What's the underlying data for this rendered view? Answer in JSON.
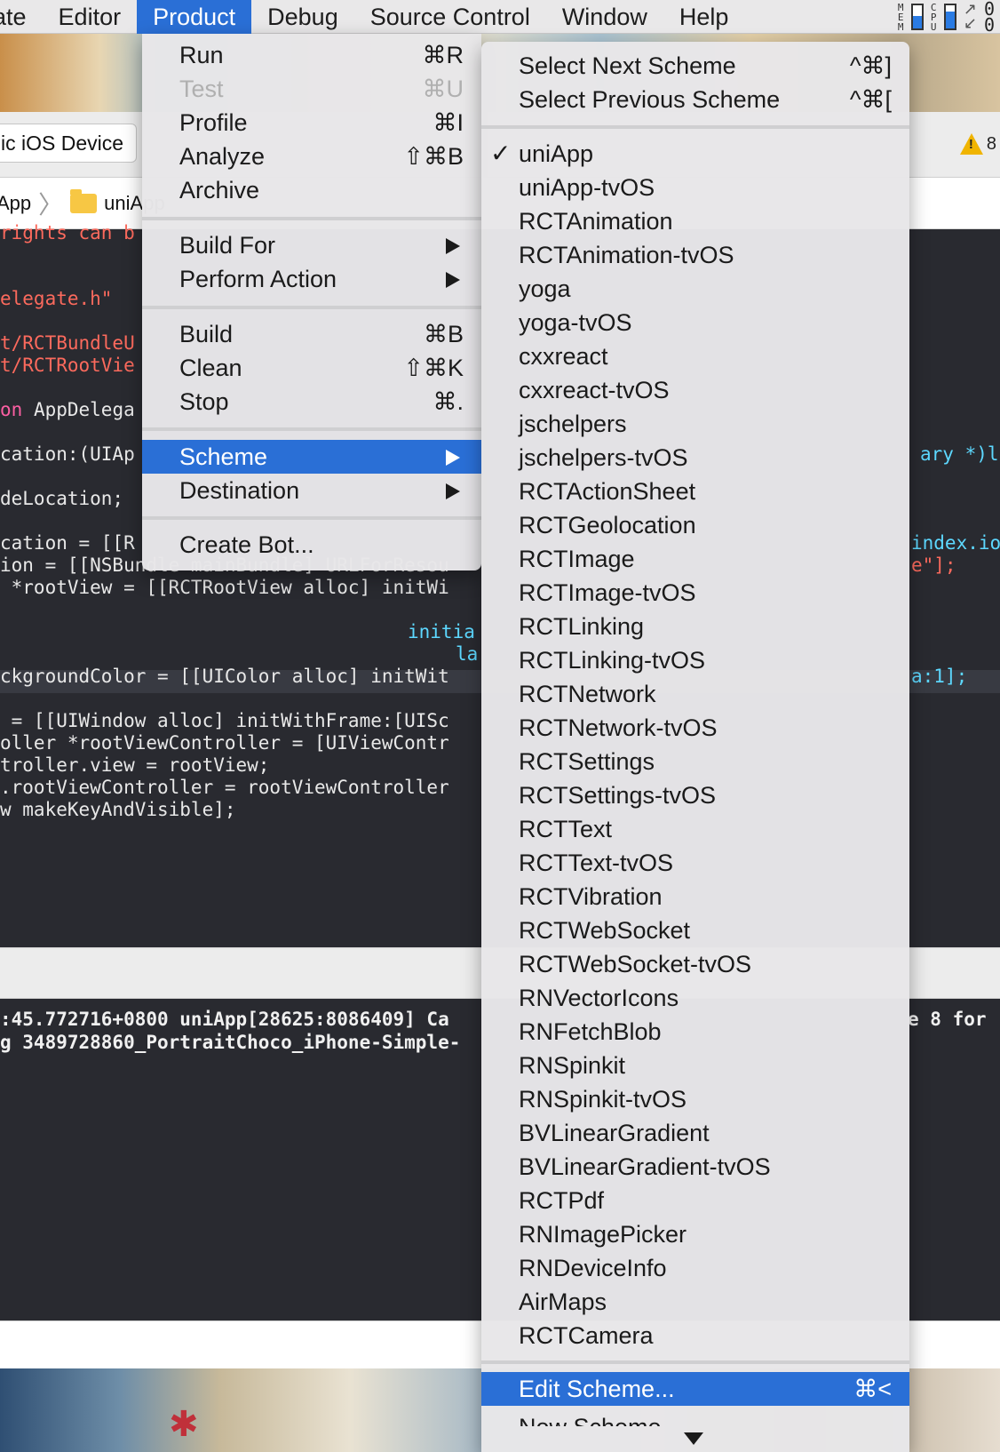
{
  "menubar": {
    "items": [
      "ate",
      "Editor",
      "Product",
      "Debug",
      "Source Control",
      "Window",
      "Help"
    ],
    "active_index": 2,
    "mem_label": "MEM",
    "cpu_label": "CPU",
    "mem_level": 0.55,
    "cpu_level": 0.75,
    "accent": "#2a6fd6"
  },
  "toolbar": {
    "device": "ic iOS Device",
    "warning_count": "8"
  },
  "jumpbar": {
    "crumbs": [
      "App",
      "uniApp"
    ]
  },
  "editor": {
    "lines": [
      {
        "t": "rights can b"
      },
      {
        "t": "elegate.h\""
      },
      {
        "t": "t/RCTBundleU"
      },
      {
        "t": "t/RCTRootVie"
      },
      {
        "t": "AppDelega",
        "pre": "on "
      },
      {
        "t": "cation:(UIAp"
      },
      {
        "t": "deLocation;"
      },
      {
        "t": "cation = [[R"
      },
      {
        "t": "ion = [[NSBundle mainBundle] URLForResou"
      },
      {
        "t": " *rootView = [[RCTRootView alloc] initWi"
      },
      {
        "t": "initia"
      },
      {
        "t": "la"
      },
      {
        "t": "ckgroundColor = [[UIColor alloc] initWit"
      },
      {
        "t": " = [[UIWindow alloc] initWithFrame:[UISc"
      },
      {
        "t": "oller *rootViewController = [UIViewContr"
      },
      {
        "t": "troller.view = rootView;"
      },
      {
        "t": ".rootViewController = rootViewController"
      },
      {
        "t": "w makeKeyAndVisible];"
      }
    ],
    "right_fragments": [
      "ary *)l",
      "index.io",
      "e\"];",
      "a:1];"
    ]
  },
  "console": {
    "lines": [
      ":45.772716+0800 uniApp[28625:8086409] Ca",
      "g 3489728860_PortraitChoco_iPhone-Simple-"
    ],
    "right_fragment": "e 8 for "
  },
  "product_menu": {
    "items": [
      {
        "label": "Run",
        "shortcut": "⌘R"
      },
      {
        "label": "Test",
        "shortcut": "⌘U",
        "disabled": true
      },
      {
        "label": "Profile",
        "shortcut": "⌘I"
      },
      {
        "label": "Analyze",
        "shortcut": "⇧⌘B"
      },
      {
        "label": "Archive",
        "shortcut": ""
      },
      {
        "label": "Build For",
        "submenu": true
      },
      {
        "label": "Perform Action",
        "submenu": true
      },
      {
        "label": "Build",
        "shortcut": "⌘B"
      },
      {
        "label": "Clean",
        "shortcut": "⇧⌘K"
      },
      {
        "label": "Stop",
        "shortcut": "⌘."
      },
      {
        "label": "Scheme",
        "submenu": true,
        "selected": true
      },
      {
        "label": "Destination",
        "submenu": true
      },
      {
        "label": "Create Bot..."
      }
    ]
  },
  "scheme_menu": {
    "select_next": {
      "label": "Select Next Scheme",
      "shortcut": "^⌘]"
    },
    "select_previous": {
      "label": "Select Previous Scheme",
      "shortcut": "^⌘["
    },
    "check_mark": "✓",
    "schemes": [
      "uniApp",
      "uniApp-tvOS",
      "RCTAnimation",
      "RCTAnimation-tvOS",
      "yoga",
      "yoga-tvOS",
      "cxxreact",
      "cxxreact-tvOS",
      "jschelpers",
      "jschelpers-tvOS",
      "RCTActionSheet",
      "RCTGeolocation",
      "RCTImage",
      "RCTImage-tvOS",
      "RCTLinking",
      "RCTLinking-tvOS",
      "RCTNetwork",
      "RCTNetwork-tvOS",
      "RCTSettings",
      "RCTSettings-tvOS",
      "RCTText",
      "RCTText-tvOS",
      "RCTVibration",
      "RCTWebSocket",
      "RCTWebSocket-tvOS",
      "RNVectorIcons",
      "RNFetchBlob",
      "RNSpinkit",
      "RNSpinkit-tvOS",
      "BVLinearGradient",
      "BVLinearGradient-tvOS",
      "RCTPdf",
      "RNImagePicker",
      "RNDeviceInfo",
      "AirMaps",
      "RCTCamera"
    ],
    "checked_index": 0,
    "edit_scheme": {
      "label": "Edit Scheme...",
      "shortcut": "⌘<"
    },
    "new_scheme": "New Scheme..."
  }
}
